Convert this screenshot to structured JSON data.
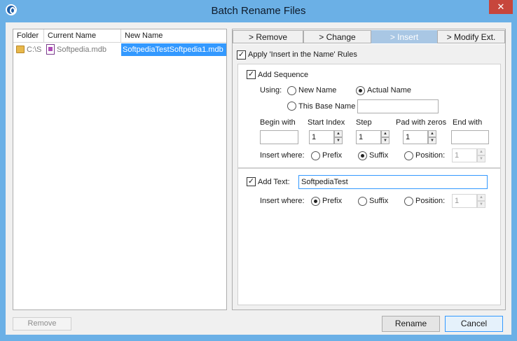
{
  "window": {
    "title": "Batch Rename Files",
    "close_label": "✕"
  },
  "file_list": {
    "columns": [
      "Folder",
      "Current Name",
      "New Name"
    ],
    "rows": [
      {
        "folder": "C:\\S",
        "current_name": "Softpedia.mdb",
        "new_name": "SoftpediaTestSoftpedia1.mdb"
      }
    ]
  },
  "left_buttons": {
    "remove": "Remove"
  },
  "tabs": [
    {
      "label": "> Remove",
      "active": false
    },
    {
      "label": "> Change",
      "active": false
    },
    {
      "label": "> Insert",
      "active": true
    },
    {
      "label": "> Modify Ext.",
      "active": false
    }
  ],
  "insert": {
    "apply_label": "Apply 'Insert in the Name' Rules",
    "apply_checked": true,
    "sequence": {
      "label": "Add Sequence",
      "checked": true,
      "using_label": "Using:",
      "using_options": [
        "New Name",
        "Actual Name",
        "This Base Name"
      ],
      "using_selected": "Actual Name",
      "base_name_value": "",
      "begin_with_label": "Begin with",
      "begin_with_value": "",
      "start_index_label": "Start Index",
      "start_index_value": "1",
      "step_label": "Step",
      "step_value": "1",
      "pad_label": "Pad with zeros",
      "pad_value": "1",
      "end_with_label": "End with",
      "end_with_value": "",
      "insert_where_label": "Insert where:",
      "insert_options": [
        "Prefix",
        "Suffix",
        "Position:"
      ],
      "insert_selected": "Suffix",
      "position_value": "1"
    },
    "text": {
      "label": "Add Text:",
      "checked": true,
      "value": "SoftpediaTest",
      "insert_where_label": "Insert where:",
      "insert_options": [
        "Prefix",
        "Suffix",
        "Position:"
      ],
      "insert_selected": "Prefix",
      "position_value": "1"
    }
  },
  "footer": {
    "rename": "Rename",
    "cancel": "Cancel"
  },
  "colors": {
    "titlebar": "#6bb0e6",
    "selection": "#3399ff",
    "active_tab": "#a9c7e4",
    "close": "#c7463c"
  }
}
